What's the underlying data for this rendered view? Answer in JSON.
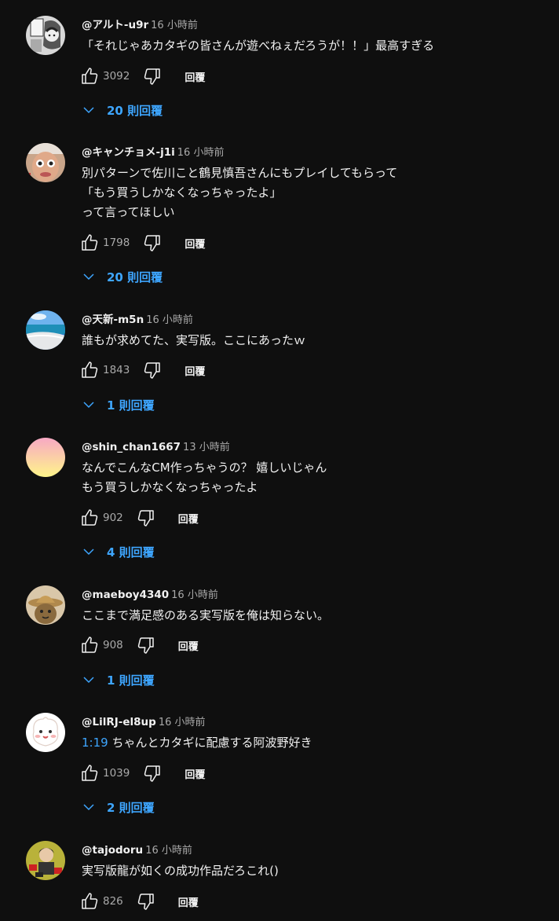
{
  "reply_label": "回覆",
  "comments": [
    {
      "author": "@アルト-u9r",
      "time": "16 小時前",
      "lines": [
        "「それじゃあカタギの皆さんが遊べねぇだろうが！！」最高すぎる"
      ],
      "likes": "3092",
      "replies": "20 則回覆",
      "avatar": "manga-avatar"
    },
    {
      "author": "@キャンチョメ-j1i",
      "time": "16 小時前",
      "lines": [
        "別パターンで佐川こと鶴見慎吾さんにもプレイしてもらって",
        "「もう買うしかなくなっちゃったよ」",
        "って言ってほしい"
      ],
      "likes": "1798",
      "replies": "20 則回覆",
      "avatar": "face-avatar"
    },
    {
      "author": "@天新-m5n",
      "time": "16 小時前",
      "lines": [
        "誰もが求めてた、実写版。ここにあったｗ"
      ],
      "likes": "1843",
      "replies": "1 則回覆",
      "avatar": "beach-avatar"
    },
    {
      "author": "@shin_chan1667",
      "time": "13 小時前",
      "lines": [
        "なんでこんなCM作っちゃうの？ 嬉しいじゃん",
        "もう買うしかなくなっちゃったよ"
      ],
      "likes": "902",
      "replies": "4 則回覆",
      "avatar": "gradient-avatar"
    },
    {
      "author": "@maeboy4340",
      "time": "16 小時前",
      "lines": [
        "ここまで満足感のある実写版を俺は知らない。"
      ],
      "likes": "908",
      "replies": "1 則回覆",
      "avatar": "hat-avatar"
    },
    {
      "author": "@LilRJ-el8up",
      "time": "16 小時前",
      "timestamp": "1:19",
      "lines": [
        " ちゃんとカタギに配慮する阿波野好き"
      ],
      "likes": "1039",
      "replies": "2 則回覆",
      "avatar": "cute-avatar"
    },
    {
      "author": "@tajodoru",
      "time": "16 小時前",
      "lines": [
        "実写版龍が如くの成功作品だろこれ()"
      ],
      "likes": "826",
      "avatar": "character-avatar"
    }
  ]
}
